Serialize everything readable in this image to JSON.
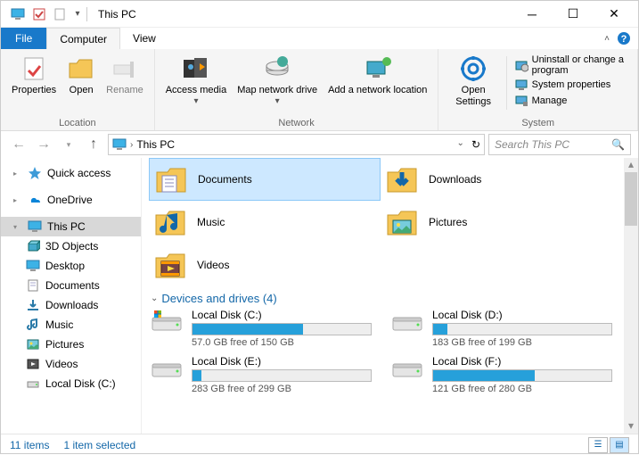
{
  "title": "This PC",
  "tabs": {
    "file": "File",
    "computer": "Computer",
    "view": "View"
  },
  "ribbon": {
    "location": {
      "label": "Location",
      "properties": "Properties",
      "open": "Open",
      "rename": "Rename"
    },
    "network": {
      "label": "Network",
      "access_media": "Access media",
      "map_drive": "Map network drive",
      "add_loc": "Add a network location"
    },
    "system": {
      "label": "System",
      "open_settings": "Open Settings",
      "uninstall": "Uninstall or change a program",
      "sys_props": "System properties",
      "manage": "Manage"
    }
  },
  "address": {
    "path": "This PC"
  },
  "search": {
    "placeholder": "Search This PC"
  },
  "sidebar": {
    "quick": "Quick access",
    "onedrive": "OneDrive",
    "thispc": "This PC",
    "items": [
      "3D Objects",
      "Desktop",
      "Documents",
      "Downloads",
      "Music",
      "Pictures",
      "Videos",
      "Local Disk (C:)"
    ]
  },
  "folders": [
    {
      "name": "Documents",
      "selected": true,
      "icon": "documents"
    },
    {
      "name": "Downloads",
      "selected": false,
      "icon": "downloads"
    },
    {
      "name": "Music",
      "selected": false,
      "icon": "music"
    },
    {
      "name": "Pictures",
      "selected": false,
      "icon": "pictures"
    },
    {
      "name": "Videos",
      "selected": false,
      "icon": "videos"
    }
  ],
  "section": "Devices and drives (4)",
  "drives": [
    {
      "name": "Local Disk (C:)",
      "free": "57.0 GB free of 150 GB",
      "pct": 62
    },
    {
      "name": "Local Disk (D:)",
      "free": "183 GB free of 199 GB",
      "pct": 8
    },
    {
      "name": "Local Disk  (E:)",
      "free": "283 GB free of 299 GB",
      "pct": 5
    },
    {
      "name": "Local Disk (F:)",
      "free": "121 GB free of 280 GB",
      "pct": 57
    }
  ],
  "status": {
    "items": "11 items",
    "selected": "1 item selected"
  }
}
